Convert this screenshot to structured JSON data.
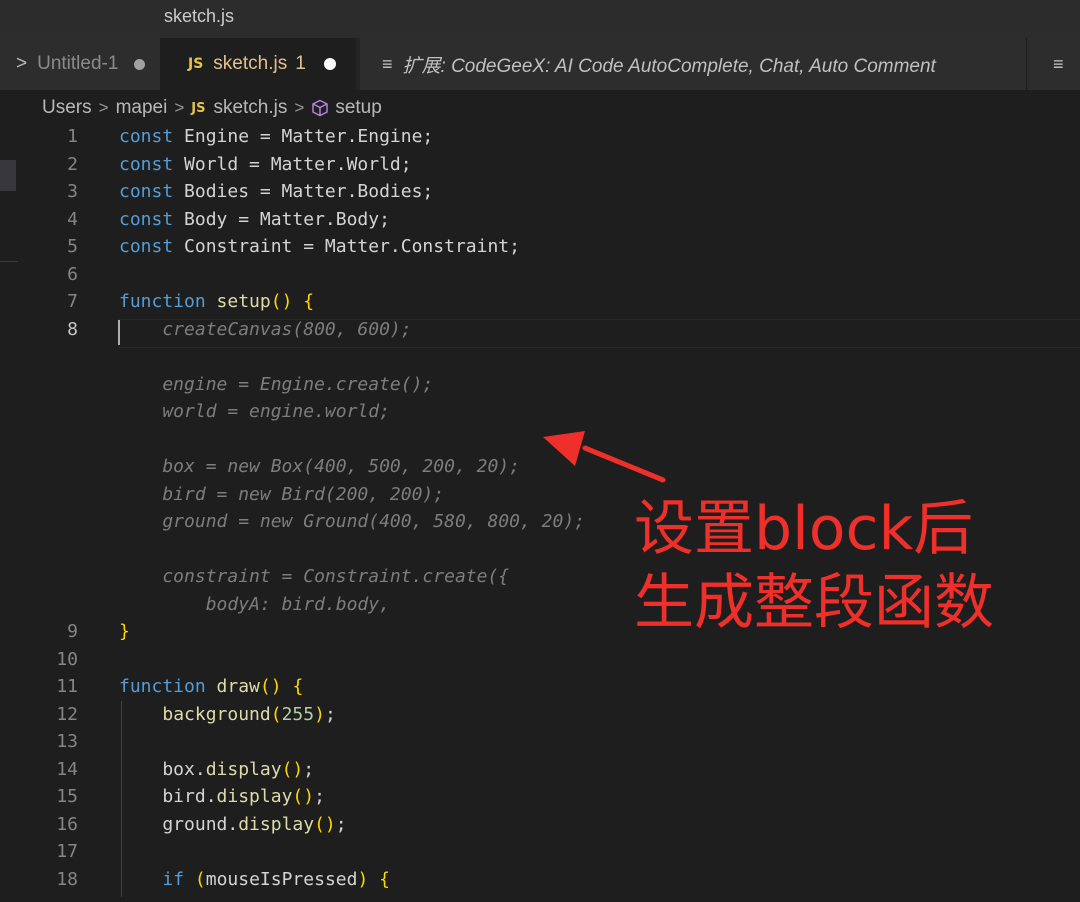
{
  "window": {
    "title": "sketch.js"
  },
  "tabs": [
    {
      "label": "Untitled-1",
      "modified": true
    },
    {
      "icon": "JS",
      "label": "sketch.js",
      "problems": "1",
      "modified": true,
      "active": true
    },
    {
      "label": "扩展: CodeGeeX: AI Code AutoComplete, Chat, Auto Comment",
      "icon_name": "preview-lines-icon"
    },
    {
      "icon_name": "preview-lines-icon"
    }
  ],
  "breadcrumb": [
    "Users",
    "mapei",
    "sketch.js",
    "setup"
  ],
  "editor": {
    "lines": [
      {
        "n": "1",
        "text": "const Engine = Matter.Engine;"
      },
      {
        "n": "2",
        "text": "const World = Matter.World;"
      },
      {
        "n": "3",
        "text": "const Bodies = Matter.Bodies;"
      },
      {
        "n": "4",
        "text": "const Body = Matter.Body;"
      },
      {
        "n": "5",
        "text": "const Constraint = Matter.Constraint;"
      },
      {
        "n": "6",
        "text": ""
      },
      {
        "n": "7",
        "text": "function setup() {"
      },
      {
        "n": "8",
        "text": "    createCanvas(800, 600);",
        "ghost": true
      },
      {
        "n": "",
        "text": "",
        "ghost": true
      },
      {
        "n": "",
        "text": "    engine = Engine.create();",
        "ghost": true
      },
      {
        "n": "",
        "text": "    world = engine.world;",
        "ghost": true
      },
      {
        "n": "",
        "text": "",
        "ghost": true
      },
      {
        "n": "",
        "text": "    box = new Box(400, 500, 200, 20);",
        "ghost": true
      },
      {
        "n": "",
        "text": "    bird = new Bird(200, 200);",
        "ghost": true
      },
      {
        "n": "",
        "text": "    ground = new Ground(400, 580, 800, 20);",
        "ghost": true
      },
      {
        "n": "",
        "text": "",
        "ghost": true
      },
      {
        "n": "",
        "text": "    constraint = Constraint.create({",
        "ghost": true
      },
      {
        "n": "",
        "text": "        bodyA: bird.body,",
        "ghost": true
      },
      {
        "n": "9",
        "text": "}"
      },
      {
        "n": "10",
        "text": ""
      },
      {
        "n": "11",
        "text": "function draw() {"
      },
      {
        "n": "12",
        "text": "    background(255);"
      },
      {
        "n": "13",
        "text": ""
      },
      {
        "n": "14",
        "text": "    box.display();"
      },
      {
        "n": "15",
        "text": "    bird.display();"
      },
      {
        "n": "16",
        "text": "    ground.display();"
      },
      {
        "n": "17",
        "text": ""
      },
      {
        "n": "18",
        "text": "    if (mouseIsPressed) {"
      }
    ],
    "active_line": "8"
  },
  "annotation": {
    "line1": "设置block后",
    "line2": "生成整段函数",
    "color": "#ef2f2a"
  },
  "colors": {
    "keyword": "#569cd6",
    "function": "#dcdcaa",
    "bracket": "#ffd700",
    "number": "#b5cea8",
    "ghost_text": "#7d7d7d",
    "background": "#1e1e1e"
  }
}
